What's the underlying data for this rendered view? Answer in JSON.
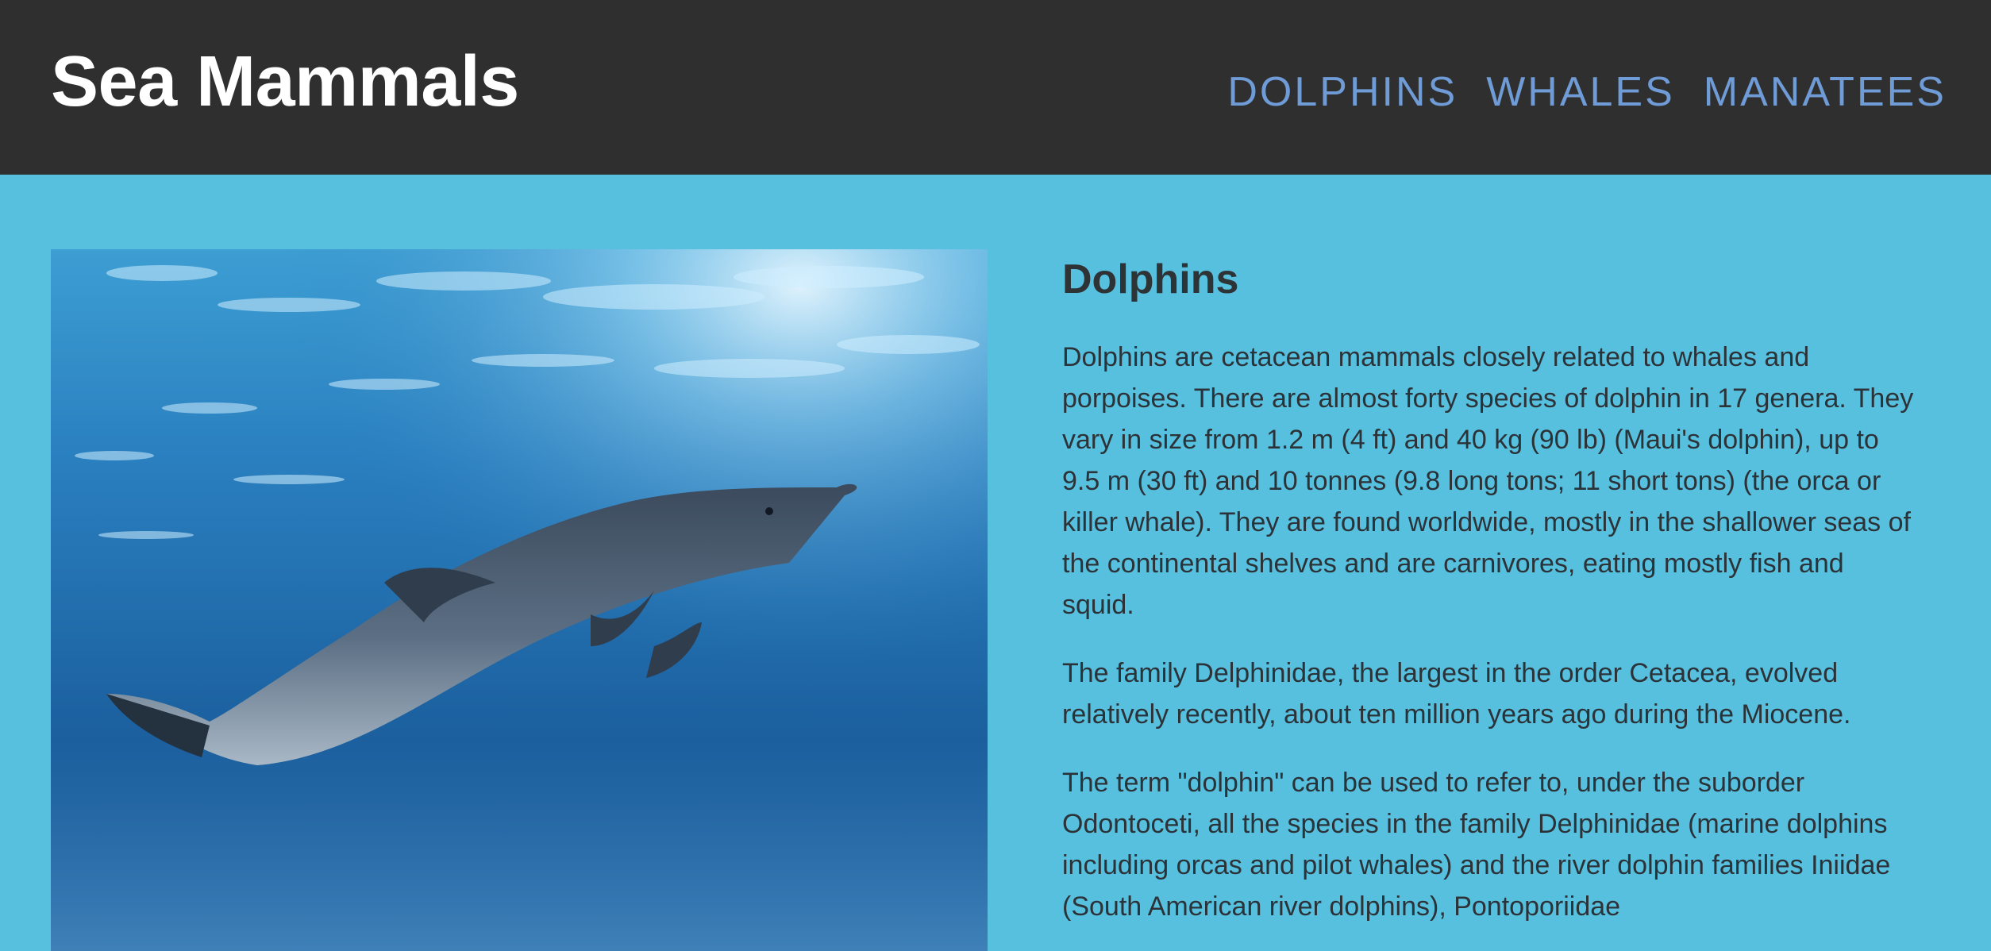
{
  "header": {
    "title": "Sea Mammals",
    "nav": [
      {
        "label": "DOLPHINS"
      },
      {
        "label": "WHALES"
      },
      {
        "label": "MANATEES"
      }
    ]
  },
  "article": {
    "heading": "Dolphins",
    "paragraphs": [
      "Dolphins are cetacean mammals closely related to whales and porpoises. There are almost forty species of dolphin in 17 genera. They vary in size from 1.2 m (4 ft) and 40 kg (90 lb) (Maui's dolphin), up to 9.5 m (30 ft) and 10 tonnes (9.8 long tons; 11 short tons) (the orca or killer whale). They are found worldwide, mostly in the shallower seas of the continental shelves and are carnivores, eating mostly fish and squid.",
      "The family Delphinidae, the largest in the order Cetacea, evolved relatively recently, about ten million years ago during the Miocene.",
      "The term \"dolphin\" can be used to refer to, under the suborder Odontoceti, all the species in the family Delphinidae (marine dolphins including orcas and pilot whales) and the river dolphin families Iniidae (South American river dolphins), Pontoporiidae"
    ]
  },
  "colors": {
    "header_bg": "#2f2f2f",
    "page_bg": "#58c0df",
    "nav_link": "#6f9bd6",
    "title": "#ffffff",
    "body_text": "#2b3338"
  },
  "icons": {
    "hero": "dolphin-photo"
  }
}
